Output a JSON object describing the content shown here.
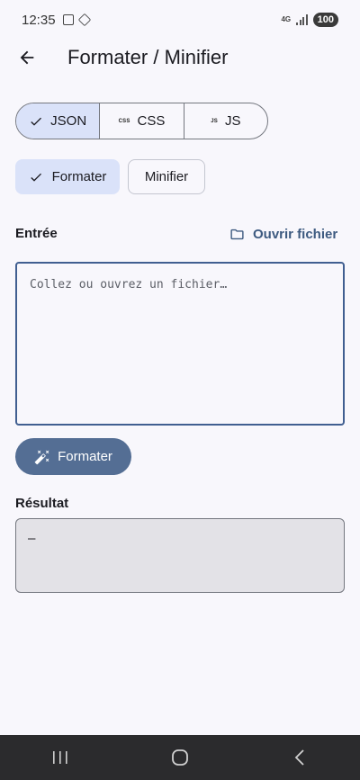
{
  "status_bar": {
    "time": "12:35",
    "network": "4G",
    "battery": "100"
  },
  "app_bar": {
    "title": "Formater / Minifier"
  },
  "language_selector": {
    "options": [
      {
        "label": "JSON",
        "tag": "",
        "selected": true
      },
      {
        "label": "CSS",
        "tag": "CSS",
        "selected": false
      },
      {
        "label": "JS",
        "tag": "JS",
        "selected": false
      }
    ]
  },
  "mode_chips": {
    "format_label": "Formater",
    "minify_label": "Minifier",
    "selected": "format"
  },
  "input_section": {
    "label": "Entrée",
    "open_file_label": "Ouvrir fichier",
    "placeholder": "Collez ou ouvrez un fichier…"
  },
  "action_button": {
    "label": "Formater"
  },
  "result_section": {
    "label": "Résultat",
    "value": "—"
  },
  "colors": {
    "accent": "#546e94",
    "selected_container": "#dae2f9",
    "link": "#3d5a80"
  }
}
